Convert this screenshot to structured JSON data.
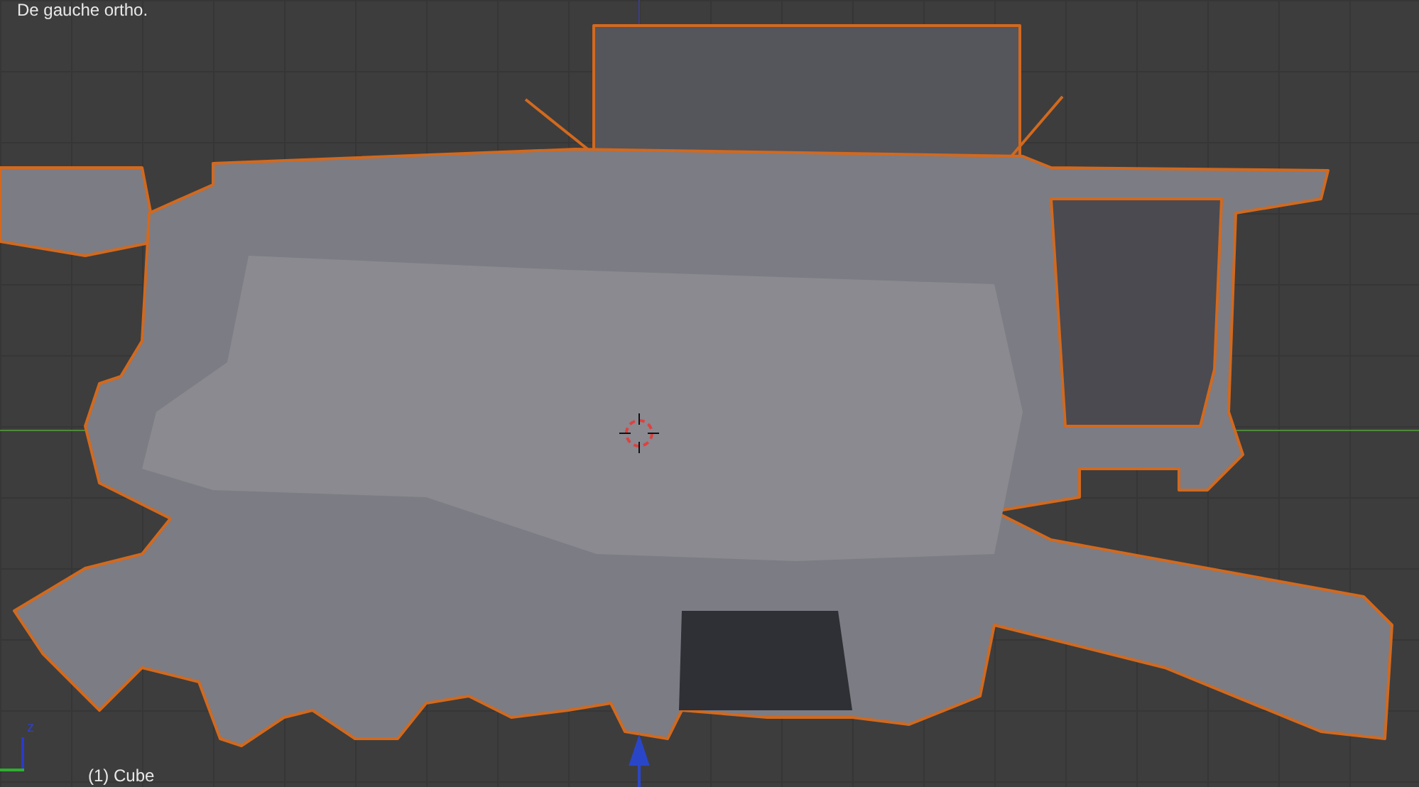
{
  "viewport": {
    "view_label": "De gauche ortho.",
    "object_label": "(1) Cube",
    "gizmo": {
      "axis_label": "z"
    }
  }
}
